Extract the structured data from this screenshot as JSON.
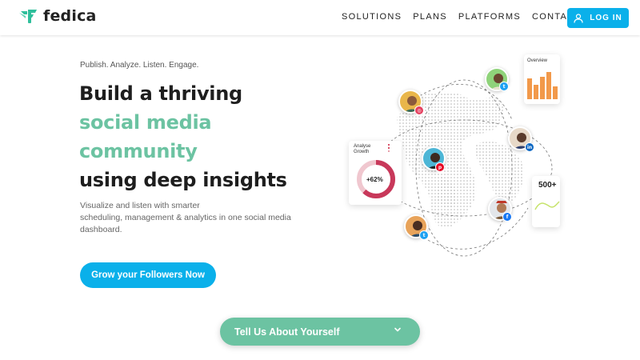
{
  "brand": {
    "name": "fedica",
    "logo_color": "#2fbf9b"
  },
  "nav": {
    "items": [
      {
        "label": "SOLUTIONS"
      },
      {
        "label": "PLANS"
      },
      {
        "label": "PLATFORMS"
      },
      {
        "label": "CONTACT"
      }
    ],
    "login_label": "LOG IN",
    "login_icon": "user-icon"
  },
  "hero": {
    "tagline": "Publish. Analyze. Listen. Engage.",
    "headline": {
      "line1": "Build a thriving",
      "line2": "social media",
      "line3": "community",
      "line4": "using deep insights"
    },
    "description": {
      "line1": "Visualize and listen with smarter",
      "line2": "scheduling, management & analytics in one social media",
      "line3": "dashboard."
    },
    "cta_label": "Grow your Followers Now"
  },
  "illustration": {
    "overview_card": {
      "title": "Overview"
    },
    "analyse_card": {
      "title_line1": "Analyse",
      "title_line2": "Growth",
      "percent": "+62%"
    },
    "followers_card": {
      "value": "500+"
    }
  },
  "tell_us": {
    "label": "Tell Us About Yourself",
    "icon": "chevron-down-icon"
  },
  "colors": {
    "accent_blue": "#0ab0ea",
    "accent_green": "#6cc3a2",
    "text_dark": "#1e1e1e"
  }
}
